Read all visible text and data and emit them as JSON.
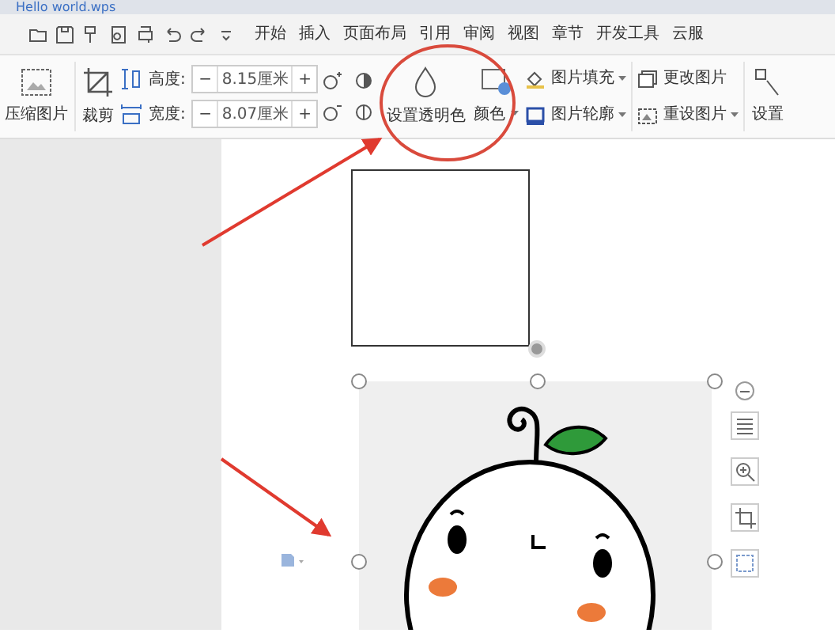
{
  "window": {
    "tab_title": "Hello world.wps"
  },
  "menu_tabs": [
    {
      "label": "开始",
      "selected": false
    },
    {
      "label": "插入",
      "selected": false
    },
    {
      "label": "页面布局",
      "selected": false
    },
    {
      "label": "引用",
      "selected": false
    },
    {
      "label": "审阅",
      "selected": false
    },
    {
      "label": "视图",
      "selected": false
    },
    {
      "label": "章节",
      "selected": false
    },
    {
      "label": "开发工具",
      "selected": false
    },
    {
      "label": "云服",
      "selected": false
    }
  ],
  "ribbon": {
    "compress": "压缩图片",
    "crop": "裁剪",
    "size_fields": [
      {
        "label": "高度:",
        "value": "8.15厘米",
        "minus": "−",
        "plus": "+"
      },
      {
        "label": "宽度:",
        "value": "8.07厘米",
        "minus": "−",
        "plus": "+"
      }
    ],
    "set_transparent": "设置透明色",
    "color": {
      "label": "颜色",
      "dropdown": true
    },
    "picture_menu": [
      {
        "label": "图片填充",
        "dropdown": true
      },
      {
        "label": "图片轮廓",
        "dropdown": true
      }
    ],
    "change_menu": [
      {
        "label": "更改图片",
        "dropdown": false
      },
      {
        "label": "重设图片",
        "dropdown": true
      }
    ],
    "more": "设置"
  }
}
